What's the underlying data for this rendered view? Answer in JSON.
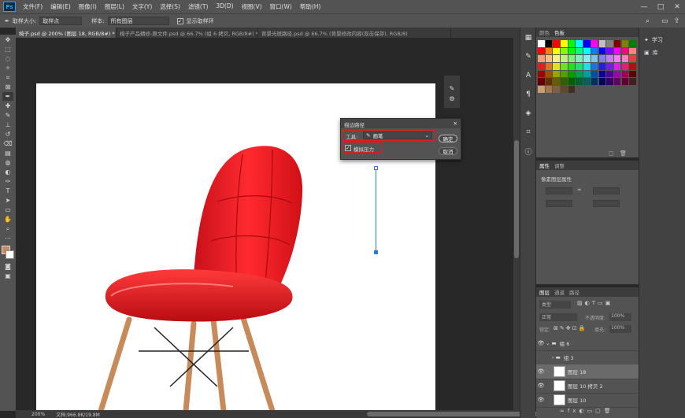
{
  "menu": {
    "logo": "Ps",
    "items": [
      "文件(F)",
      "编辑(E)",
      "图像(I)",
      "图层(L)",
      "文字(Y)",
      "选择(S)",
      "滤镜(T)",
      "3D(D)",
      "视图(V)",
      "窗口(W)",
      "帮助(H)"
    ],
    "minimize": "—",
    "maximize": "□",
    "close": "✕"
  },
  "options": {
    "sample_size_label": "取样大小:",
    "sample_size_value": "取样点",
    "sample_label": "样本:",
    "sample_value": "所有图层",
    "show_ring_label": "显示取样环"
  },
  "tabs": [
    "椅子.psd @ 200% (图层 18, RGB/8#) *",
    "椅子产品精修-原文件.psd @ 66.7% (组 6 拷贝, RGB/8#) *",
    "背景光斑路径.psd @ 66.7% (背景修改内容(双击保存), RGB/8)"
  ],
  "status": {
    "zoom": "200%",
    "doc": "文档:966.8K/19.8M"
  },
  "dialog": {
    "title": "描边路径",
    "close": "✕",
    "tool_label": "工具:",
    "tool_value": "画笔",
    "simulate_pressure": "模拟压力",
    "ok": "确定",
    "cancel": "取消"
  },
  "panels": {
    "swatch_tabs": [
      "颜色",
      "色板"
    ],
    "properties_tabs": [
      "属性",
      "调整"
    ],
    "properties_subtitle": "像素图层属性",
    "layers_tabs": [
      "图层",
      "通道",
      "路径"
    ],
    "kind_label": "类型",
    "blend_mode": "正常",
    "opacity_label": "不透明度:",
    "opacity_value": "100%",
    "lock_label": "锁定:",
    "fill_label": "填充:",
    "fill_value": "100%"
  },
  "layers": [
    {
      "name": "组 6",
      "type": "group",
      "visible": true
    },
    {
      "name": "组 3",
      "type": "group",
      "visible": false
    },
    {
      "name": "图层 18",
      "type": "layer",
      "visible": true,
      "selected": true
    },
    {
      "name": "图层 10 拷贝 2",
      "type": "layer",
      "visible": true
    },
    {
      "name": "图层 10",
      "type": "layer",
      "visible": true
    }
  ],
  "right": {
    "learn": "学习",
    "library": "库"
  },
  "colors": {
    "foreground": "#c88860",
    "background": "#ffffff",
    "chair_red": "#e5151d"
  }
}
